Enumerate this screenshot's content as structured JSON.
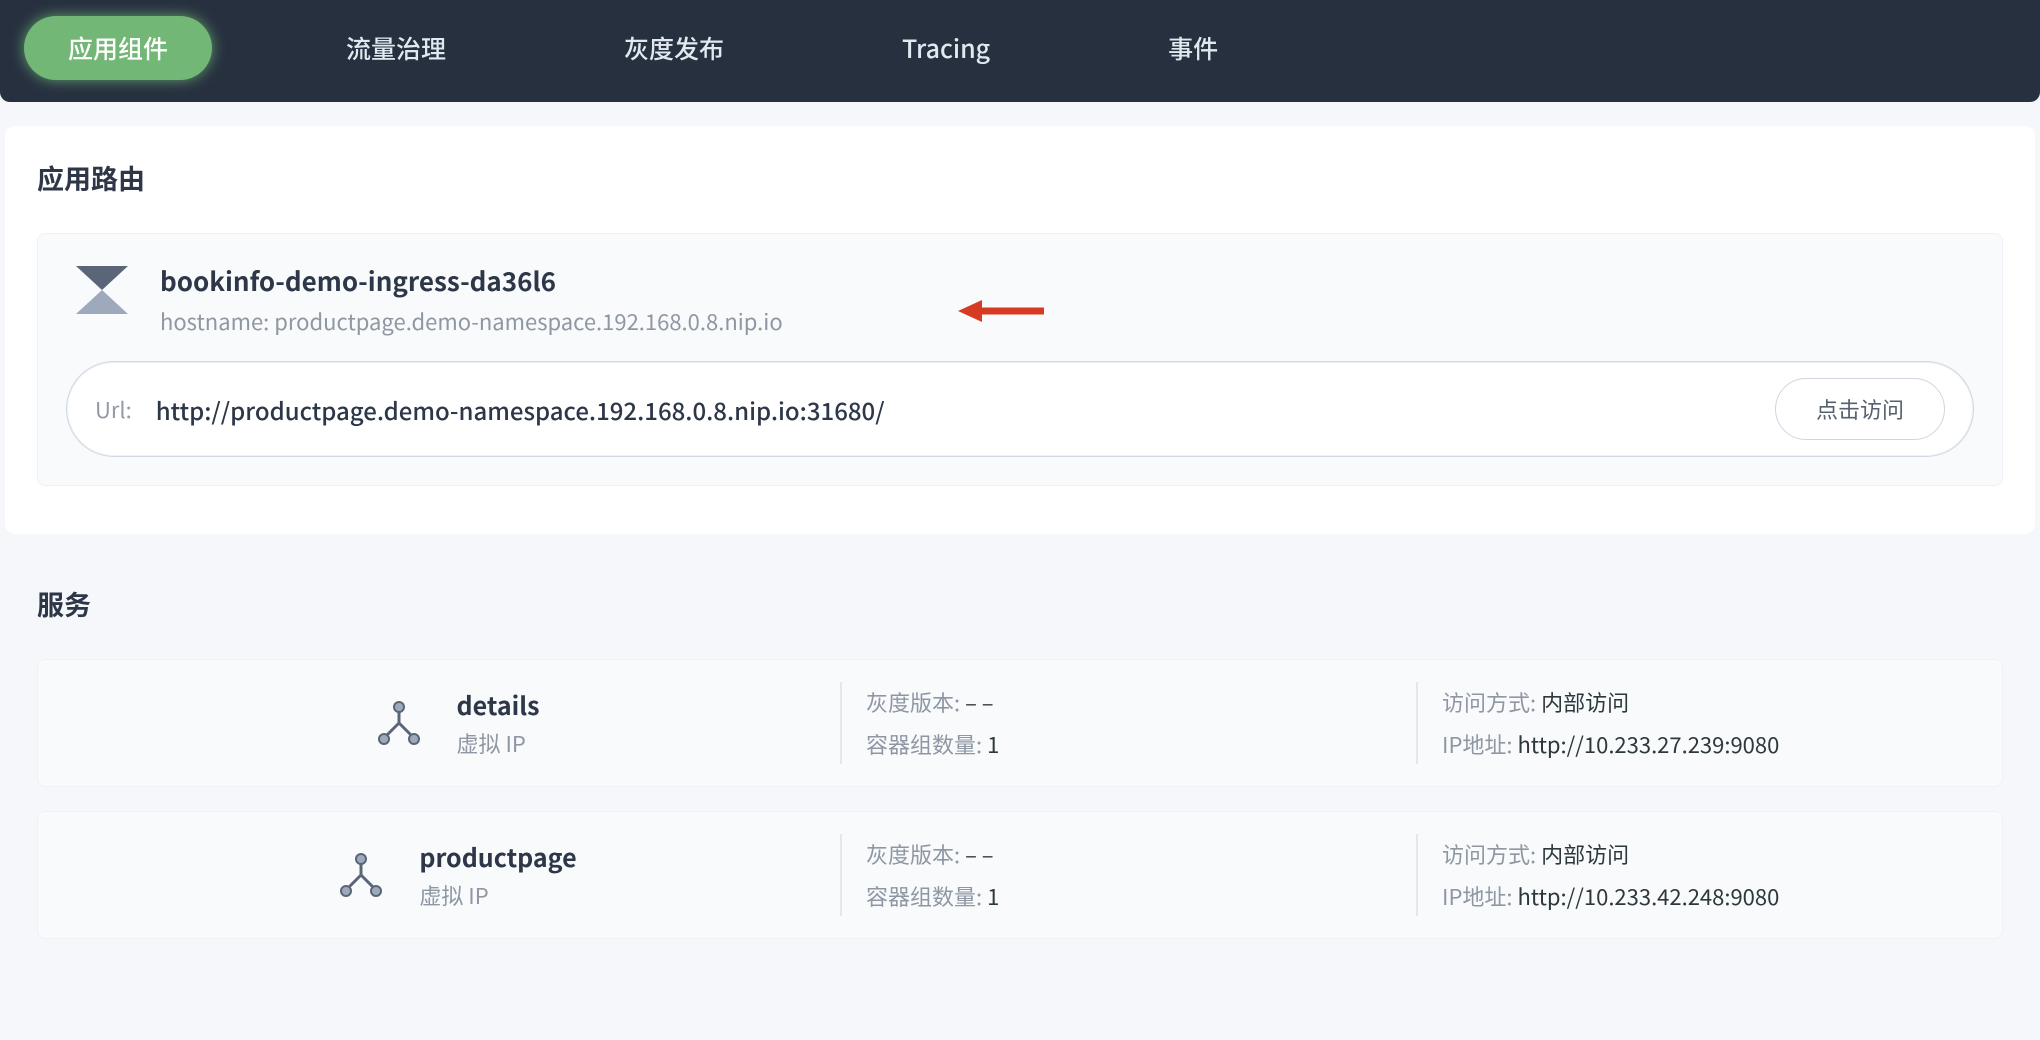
{
  "nav": {
    "tabs": [
      "应用组件",
      "流量治理",
      "灰度发布",
      "Tracing",
      "事件"
    ],
    "active_index": 0
  },
  "route_section": {
    "title": "应用路由",
    "card": {
      "icon": "hourglass-icon",
      "name": "bookinfo-demo-ingress-da36l6",
      "hostname_label": "hostname:",
      "hostname_value": "productpage.demo-namespace.192.168.0.8.nip.io",
      "url_label": "Url:",
      "url_value": "http://productpage.demo-namespace.192.168.0.8.nip.io:31680/",
      "visit_label": "点击访问"
    }
  },
  "services_section": {
    "title": "服务",
    "gray_version_label": "灰度版本:",
    "pod_count_label": "容器组数量:",
    "access_mode_label": "访问方式:",
    "ip_label": "IP地址:",
    "items": [
      {
        "name": "details",
        "ip_type": "虚拟 IP",
        "gray_version": "– –",
        "pod_count": "1",
        "access_mode": "内部访问",
        "ip_address": "http://10.233.27.239:9080"
      },
      {
        "name": "productpage",
        "ip_type": "虚拟 IP",
        "gray_version": "– –",
        "pod_count": "1",
        "access_mode": "内部访问",
        "ip_address": "http://10.233.42.248:9080"
      }
    ]
  }
}
